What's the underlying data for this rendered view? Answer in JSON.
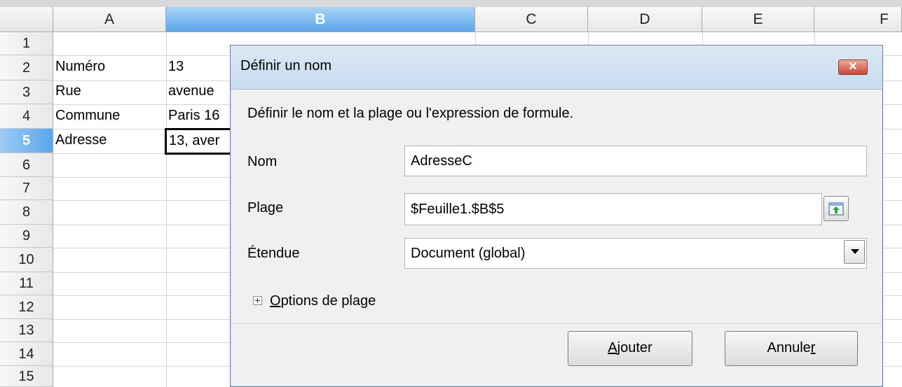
{
  "spreadsheet": {
    "columns": [
      "A",
      "B",
      "C",
      "D",
      "E",
      "F"
    ],
    "selected_column": "B",
    "rows": [
      "1",
      "2",
      "3",
      "4",
      "5",
      "6",
      "7",
      "8",
      "9",
      "10",
      "11",
      "12",
      "13",
      "14",
      "15"
    ],
    "selected_row": "5",
    "cells": {
      "A2": "Numéro",
      "B2": "13",
      "A3": "Rue",
      "B3": "avenue",
      "A4": "Commune",
      "B4": "Paris 16",
      "A5": "Adresse",
      "B5": "13, aver"
    }
  },
  "dialog": {
    "title": "Définir un nom",
    "close_symbol": "✕",
    "description": "Définir le nom et la plage ou l'expression de formule.",
    "name_label": "Nom",
    "name_value": "AdresseC",
    "range_label": "Plage",
    "range_value": "$Feuille1.$B$5",
    "scope_label": "Étendue",
    "scope_value": "Document (global)",
    "options_label_accel": "O",
    "options_label_rest": "ptions de plage",
    "add_accel": "A",
    "add_rest": "jouter",
    "cancel_main": "Annule",
    "cancel_accel": "r"
  }
}
